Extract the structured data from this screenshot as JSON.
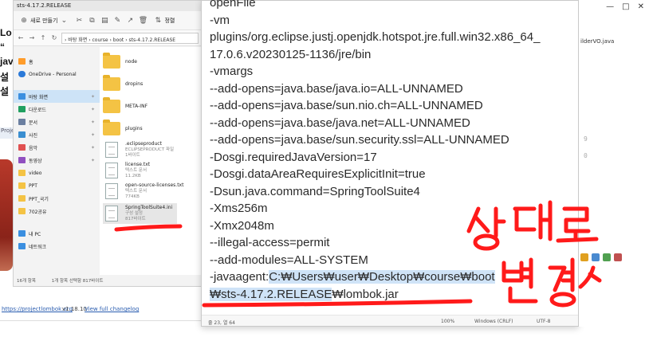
{
  "background": {
    "left_lines": [
      "Lo",
      "“",
      "jav",
      "설",
      "설"
    ],
    "project_tab": "Proje",
    "link1": "https://projectlombok.org",
    "link_ver": "v1.18.10",
    "link2": "View full changelog"
  },
  "explorer": {
    "title": "sts-4.17.2.RELEASE",
    "bg_tab": "",
    "toolbar": {
      "new_label": "새로 만들기",
      "sort_label": "정렬"
    },
    "address": "›  바탕 화면  › course  › boot  › sts-4.17.2.RELEASE",
    "nav": [
      {
        "label": "홈",
        "icon": "home-icon",
        "color": "#ff9c2a"
      },
      {
        "label": "OneDrive - Personal",
        "icon": "cloud-icon",
        "color": "#2b79d8"
      },
      {
        "label": "바탕 화면",
        "icon": "desktop-icon",
        "color": "#3b8fe0",
        "selected": true
      },
      {
        "label": "다운로드",
        "icon": "download-icon",
        "color": "#20a060"
      },
      {
        "label": "문서",
        "icon": "document-icon",
        "color": "#6b7fa0"
      },
      {
        "label": "사진",
        "icon": "picture-icon",
        "color": "#3a8ed0"
      },
      {
        "label": "음악",
        "icon": "music-icon",
        "color": "#e05050"
      },
      {
        "label": "동영상",
        "icon": "video-icon",
        "color": "#9050c0"
      },
      {
        "label": "video",
        "icon": "folder-icon",
        "color": "#f4c344"
      },
      {
        "label": "PPT",
        "icon": "folder-icon",
        "color": "#f4c344"
      },
      {
        "label": "PPT_국기",
        "icon": "folder-icon",
        "color": "#f4c344"
      },
      {
        "label": "702공유",
        "icon": "folder-icon",
        "color": "#f4c344"
      },
      {
        "label": "내 PC",
        "icon": "pc-icon",
        "color": "#3b8fe0"
      },
      {
        "label": "네트워크",
        "icon": "network-icon",
        "color": "#3b8fe0"
      }
    ],
    "files": [
      {
        "name": "node",
        "type": "folder"
      },
      {
        "name": "dropins",
        "type": "folder"
      },
      {
        "name": "META-INF",
        "type": "folder"
      },
      {
        "name": "plugins",
        "type": "folder"
      },
      {
        "name": ".eclipseproduct",
        "type": "file",
        "sub1": "ECLIPSEPRODUCT 파일",
        "sub2": "1바이트"
      },
      {
        "name": "license.txt",
        "type": "file",
        "sub1": "텍스트 문서",
        "sub2": "11.2KB"
      },
      {
        "name": "open-source-licenses.txt",
        "type": "file",
        "sub1": "텍스트 문서",
        "sub2": "774KB"
      },
      {
        "name": "SpringToolSuite4.ini",
        "type": "file",
        "sub1": "구성 설정",
        "sub2": "817바이트",
        "selected": true
      }
    ],
    "status_count": "16개 항목",
    "status_selected": "1개 항목 선택함 817바이트"
  },
  "notepad": {
    "lines": [
      "openFile",
      "-vm",
      "plugins/org.eclipse.justj.openjdk.hotspot.jre.full.win32.x86_64_",
      "17.0.6.v20230125-1136/jre/bin",
      "-vmargs",
      "--add-opens=java.base/java.io=ALL-UNNAMED",
      "--add-opens=java.base/sun.nio.ch=ALL-UNNAMED",
      "--add-opens=java.base/java.net=ALL-UNNAMED",
      "--add-opens=java.base/sun.security.ssl=ALL-UNNAMED",
      "-Dosgi.requiredJavaVersion=17",
      "-Dosgi.dataAreaRequiresExplicitInit=true",
      "-Dsun.java.command=SpringToolSuite4",
      "-Xms256m",
      "-Xmx2048m",
      "--illegal-access=permit",
      "--add-modules=ALL-SYSTEM"
    ],
    "javaagent_prefix": "-javaagent:",
    "javaagent_path": "C:₩Users₩user₩Desktop₩course₩boot",
    "last_line_highlight": "₩sts-4.17.2.RELEASE",
    "last_line_rest": "₩lombok.jar",
    "status_pos": "줄 23, 열 64",
    "status_zoom": "100%",
    "status_eol": "Windows (CRLF)",
    "status_enc": "UTF-8"
  },
  "ide": {
    "tab": "ilderVO.java",
    "gutter": [
      "",
      "",
      "",
      "",
      "",
      "9",
      "0",
      "",
      "",
      "",
      "",
      "",
      "",
      "",
      "",
      ""
    ]
  },
  "annotation": {
    "text": "상대로 변경",
    "color": "#ff1a1a"
  }
}
